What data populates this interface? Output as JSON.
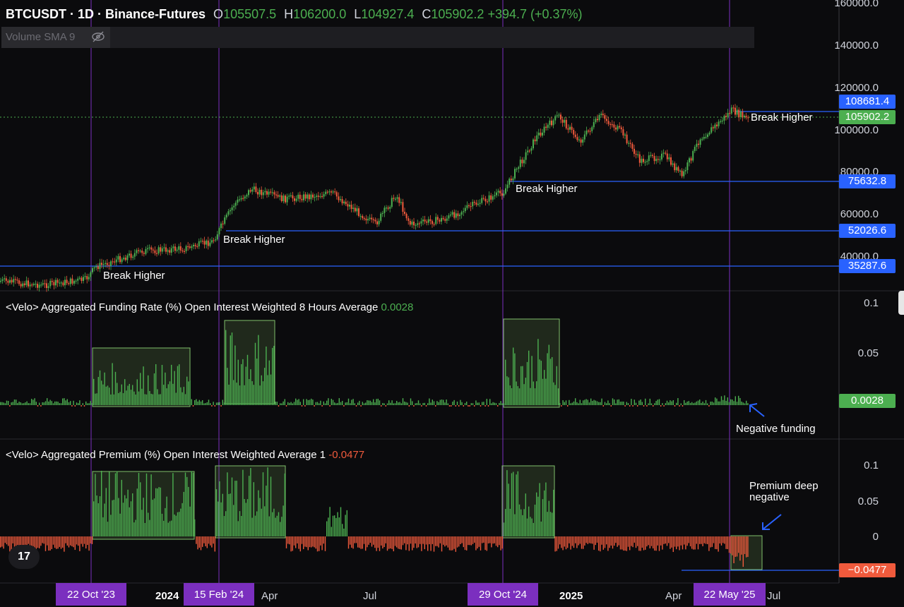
{
  "header": {
    "symbol": "BTCUSDT · 1D · Binance-Futures",
    "open_label": "O",
    "open": "105507.5",
    "high_label": "H",
    "high": "106200.0",
    "low_label": "L",
    "low": "104927.4",
    "close_label": "C",
    "close": "105902.2",
    "change": "+394.7 (+0.37%)"
  },
  "volume_indicator": {
    "label": "Volume SMA 9",
    "icon": "eye-slash-icon"
  },
  "colors": {
    "up": "#4caf50",
    "down": "#f05a3c",
    "level_line": "#2962ff",
    "event_line": "#7b2fbf",
    "bg": "#0b0b0d"
  },
  "price_axis": [
    "160000.0",
    "140000.0",
    "120000.0",
    "100000.0",
    "80000.0",
    "60000.0",
    "40000.0"
  ],
  "price_tags": [
    {
      "value": "108681.4",
      "kind": "level"
    },
    {
      "value": "105902.2",
      "kind": "last"
    },
    {
      "value": "75632.8",
      "kind": "level"
    },
    {
      "value": "52026.6",
      "kind": "level"
    },
    {
      "value": "35287.6",
      "kind": "level"
    }
  ],
  "annotations": {
    "break1": "Break Higher",
    "break2": "Break Higher",
    "break3": "Break Higher",
    "break4": "Break Higher",
    "neg_funding": "Negative funding",
    "premium_neg": "Premium deep negative"
  },
  "funding_panel": {
    "title": "<Velo> Aggregated Funding Rate (%) Open Interest Weighted 8 Hours Average",
    "value": "0.0028",
    "axis": [
      "0.1",
      "0.05"
    ],
    "last_tag": "0.0028"
  },
  "premium_panel": {
    "title": "<Velo> Aggregated Premium (%) Open Interest Weighted Average 1",
    "value": "-0.0477",
    "axis": [
      "0.1",
      "0.05",
      "0"
    ],
    "last_tag": "−0.0477"
  },
  "time_axis": {
    "labels": [
      "2024",
      "Apr",
      "Jul",
      "2025",
      "Apr",
      "Jul"
    ],
    "event_tags": [
      "22 Oct '23",
      "15 Feb '24",
      "29 Oct '24",
      "22 May '25"
    ]
  },
  "logo_text": "17"
}
